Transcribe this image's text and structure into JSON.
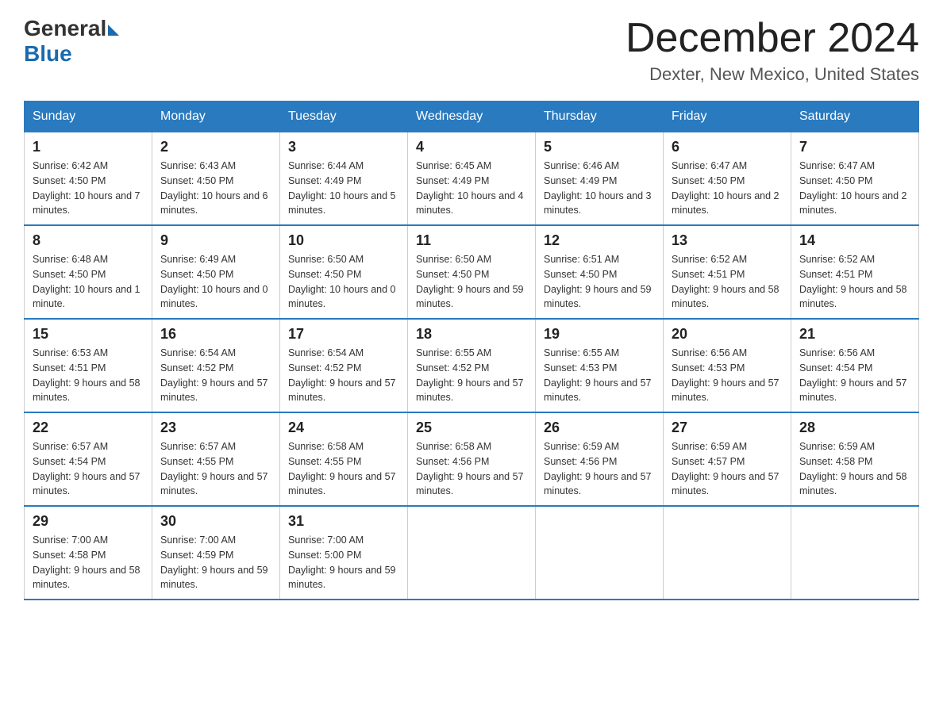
{
  "header": {
    "logo_general": "General",
    "logo_blue": "Blue",
    "month_title": "December 2024",
    "location": "Dexter, New Mexico, United States"
  },
  "days_of_week": [
    "Sunday",
    "Monday",
    "Tuesday",
    "Wednesday",
    "Thursday",
    "Friday",
    "Saturday"
  ],
  "weeks": [
    [
      {
        "day": "1",
        "sunrise": "6:42 AM",
        "sunset": "4:50 PM",
        "daylight": "10 hours and 7 minutes."
      },
      {
        "day": "2",
        "sunrise": "6:43 AM",
        "sunset": "4:50 PM",
        "daylight": "10 hours and 6 minutes."
      },
      {
        "day": "3",
        "sunrise": "6:44 AM",
        "sunset": "4:49 PM",
        "daylight": "10 hours and 5 minutes."
      },
      {
        "day": "4",
        "sunrise": "6:45 AM",
        "sunset": "4:49 PM",
        "daylight": "10 hours and 4 minutes."
      },
      {
        "day": "5",
        "sunrise": "6:46 AM",
        "sunset": "4:49 PM",
        "daylight": "10 hours and 3 minutes."
      },
      {
        "day": "6",
        "sunrise": "6:47 AM",
        "sunset": "4:50 PM",
        "daylight": "10 hours and 2 minutes."
      },
      {
        "day": "7",
        "sunrise": "6:47 AM",
        "sunset": "4:50 PM",
        "daylight": "10 hours and 2 minutes."
      }
    ],
    [
      {
        "day": "8",
        "sunrise": "6:48 AM",
        "sunset": "4:50 PM",
        "daylight": "10 hours and 1 minute."
      },
      {
        "day": "9",
        "sunrise": "6:49 AM",
        "sunset": "4:50 PM",
        "daylight": "10 hours and 0 minutes."
      },
      {
        "day": "10",
        "sunrise": "6:50 AM",
        "sunset": "4:50 PM",
        "daylight": "10 hours and 0 minutes."
      },
      {
        "day": "11",
        "sunrise": "6:50 AM",
        "sunset": "4:50 PM",
        "daylight": "9 hours and 59 minutes."
      },
      {
        "day": "12",
        "sunrise": "6:51 AM",
        "sunset": "4:50 PM",
        "daylight": "9 hours and 59 minutes."
      },
      {
        "day": "13",
        "sunrise": "6:52 AM",
        "sunset": "4:51 PM",
        "daylight": "9 hours and 58 minutes."
      },
      {
        "day": "14",
        "sunrise": "6:52 AM",
        "sunset": "4:51 PM",
        "daylight": "9 hours and 58 minutes."
      }
    ],
    [
      {
        "day": "15",
        "sunrise": "6:53 AM",
        "sunset": "4:51 PM",
        "daylight": "9 hours and 58 minutes."
      },
      {
        "day": "16",
        "sunrise": "6:54 AM",
        "sunset": "4:52 PM",
        "daylight": "9 hours and 57 minutes."
      },
      {
        "day": "17",
        "sunrise": "6:54 AM",
        "sunset": "4:52 PM",
        "daylight": "9 hours and 57 minutes."
      },
      {
        "day": "18",
        "sunrise": "6:55 AM",
        "sunset": "4:52 PM",
        "daylight": "9 hours and 57 minutes."
      },
      {
        "day": "19",
        "sunrise": "6:55 AM",
        "sunset": "4:53 PM",
        "daylight": "9 hours and 57 minutes."
      },
      {
        "day": "20",
        "sunrise": "6:56 AM",
        "sunset": "4:53 PM",
        "daylight": "9 hours and 57 minutes."
      },
      {
        "day": "21",
        "sunrise": "6:56 AM",
        "sunset": "4:54 PM",
        "daylight": "9 hours and 57 minutes."
      }
    ],
    [
      {
        "day": "22",
        "sunrise": "6:57 AM",
        "sunset": "4:54 PM",
        "daylight": "9 hours and 57 minutes."
      },
      {
        "day": "23",
        "sunrise": "6:57 AM",
        "sunset": "4:55 PM",
        "daylight": "9 hours and 57 minutes."
      },
      {
        "day": "24",
        "sunrise": "6:58 AM",
        "sunset": "4:55 PM",
        "daylight": "9 hours and 57 minutes."
      },
      {
        "day": "25",
        "sunrise": "6:58 AM",
        "sunset": "4:56 PM",
        "daylight": "9 hours and 57 minutes."
      },
      {
        "day": "26",
        "sunrise": "6:59 AM",
        "sunset": "4:56 PM",
        "daylight": "9 hours and 57 minutes."
      },
      {
        "day": "27",
        "sunrise": "6:59 AM",
        "sunset": "4:57 PM",
        "daylight": "9 hours and 57 minutes."
      },
      {
        "day": "28",
        "sunrise": "6:59 AM",
        "sunset": "4:58 PM",
        "daylight": "9 hours and 58 minutes."
      }
    ],
    [
      {
        "day": "29",
        "sunrise": "7:00 AM",
        "sunset": "4:58 PM",
        "daylight": "9 hours and 58 minutes."
      },
      {
        "day": "30",
        "sunrise": "7:00 AM",
        "sunset": "4:59 PM",
        "daylight": "9 hours and 59 minutes."
      },
      {
        "day": "31",
        "sunrise": "7:00 AM",
        "sunset": "5:00 PM",
        "daylight": "9 hours and 59 minutes."
      },
      null,
      null,
      null,
      null
    ]
  ]
}
